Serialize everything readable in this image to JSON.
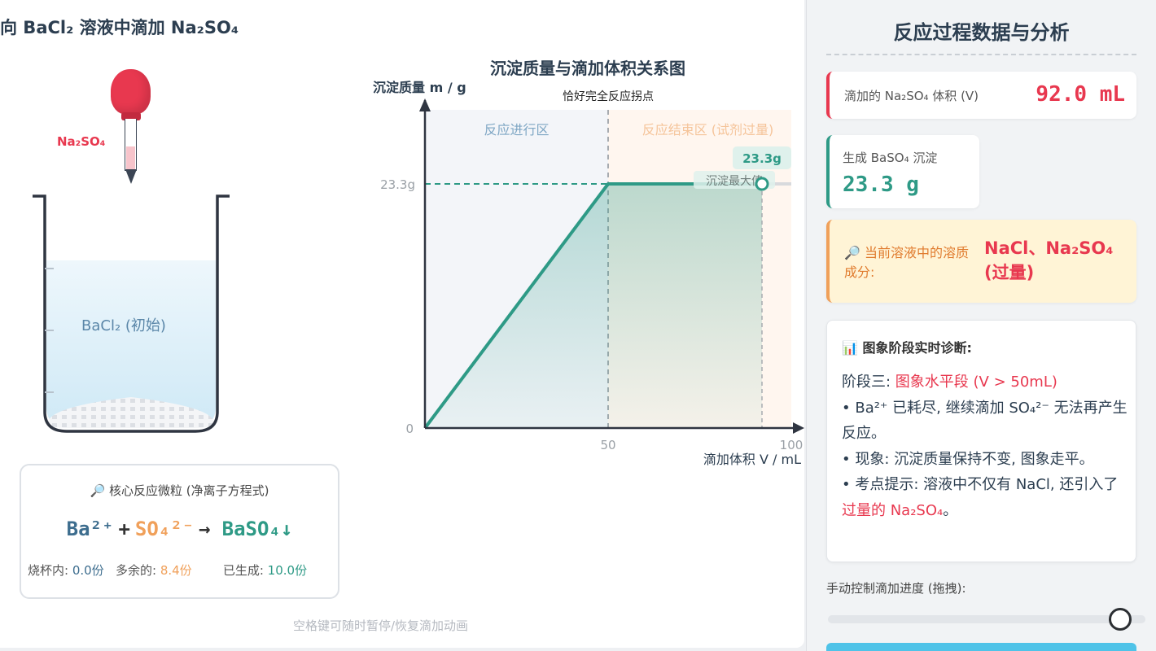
{
  "stage": {
    "title": "向 BaCl₂ 溶液中滴加 Na₂SO₄",
    "dropper_label": "Na₂SO₄",
    "beaker_label": "BaCl₂ (初始)",
    "ion_card": {
      "title": "🔎 核心反应微粒 (净离子方程式)",
      "ba": "Ba²⁺",
      "plus": "+",
      "so4": "SO₄²⁻",
      "arrow": "→",
      "product": "BaSO₄↓",
      "stat1_label": "烧杯内: ",
      "stat1_value": "0.0份",
      "stat2_label": "多余的: ",
      "stat2_value": "8.4份",
      "stat3_label": "已生成: ",
      "stat3_value": "10.0份"
    },
    "hint": "空格键可随时暂停/恢复滴加动画"
  },
  "chart_data": {
    "type": "line",
    "title": "沉淀质量与滴加体积关系图",
    "ylabel": "沉淀质量 m / g",
    "xlabel": "滴加体积 V / mL",
    "xlim": [
      0,
      100
    ],
    "ylim": [
      0,
      23.3
    ],
    "x_ticks": [
      "50",
      "100"
    ],
    "y_ticks": [
      "0",
      "23.3g"
    ],
    "series": [
      {
        "x": [
          0,
          50,
          92
        ],
        "y": [
          0,
          23.3,
          23.3
        ]
      }
    ],
    "zones": [
      "反应进行区",
      "反应结束区 (试剂过量)"
    ],
    "annotations": {
      "inflection": "恰好完全反应拐点",
      "current_value": "23.3g",
      "current_note": "沉淀最大值",
      "current_x": 92,
      "current_y": 23.3
    },
    "colors": {
      "line": "#2e9a86",
      "dashed": "#2e9a86"
    }
  },
  "panel": {
    "title": "反应过程数据与分析",
    "volume_label": "滴加的 Na₂SO₄ 体积 (V)",
    "volume_value": "92.0 mL",
    "mass_label": "生成 BaSO₄ 沉淀",
    "mass_value": "23.3 g",
    "solute_label": "🔎 当前溶液中的溶质成分:",
    "solute_value": "NaCl、Na₂SO₄ (过量)",
    "diag_title": "📊 图象阶段实时诊断:",
    "diag_stage_prefix": "阶段三: ",
    "diag_stage_name": "图象水平段 (V > 50mL)",
    "diag_line1": "• Ba²⁺ 已耗尽, 继续滴加 SO₄²⁻ 无法再产生反应。",
    "diag_line2": "• 现象: 沉淀质量保持不变, 图象走平。",
    "diag_line3_a": "• 考点提示: 溶液中不仅有 NaCl, 还引入了",
    "diag_line3_b": "过量的 Na₂SO₄",
    "diag_line3_c": "。",
    "slider_label": "手动控制滴加进度 (拖拽):",
    "slider_progress": 0.92
  },
  "colors": {
    "accent_red": "#e8384f",
    "accent_green": "#2e9a86",
    "accent_orange": "#f0a05a"
  }
}
